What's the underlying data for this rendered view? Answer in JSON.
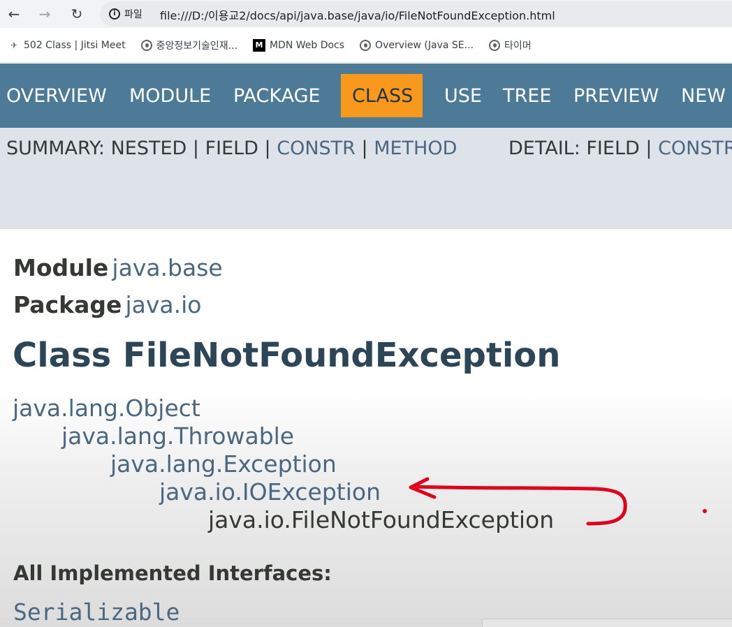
{
  "browser": {
    "info_label": "파일",
    "url": "file:///D:/이용교2/docs/api/java.base/java/io/FileNotFoundException.html",
    "bookmarks": [
      {
        "label": "502 Class | Jitsi Meet",
        "icon": "jitsi-icon"
      },
      {
        "label": "중앙정보기술인재...",
        "icon": "globe-icon"
      },
      {
        "label": "MDN Web Docs",
        "icon": "mdn-icon"
      },
      {
        "label": "Overview (Java SE...",
        "icon": "globe-icon"
      },
      {
        "label": "타이머",
        "icon": "globe-icon"
      }
    ]
  },
  "topnav": {
    "items": [
      "OVERVIEW",
      "MODULE",
      "PACKAGE",
      "CLASS",
      "USE",
      "TREE",
      "PREVIEW",
      "NEW"
    ],
    "active": "CLASS"
  },
  "subnav": {
    "summary_prefix": "SUMMARY: NESTED | FIELD | ",
    "constr": "CONSTR",
    "sep": " | ",
    "method": "METHOD",
    "detail_prefix": "DETAIL: FIELD | ",
    "detail_constr": "CONSTR"
  },
  "header": {
    "module_label": "Module",
    "module_name": "java.base",
    "package_label": "Package",
    "package_name": "java.io",
    "class_title": "Class FileNotFoundException"
  },
  "inheritance": [
    "java.lang.Object",
    "java.lang.Throwable",
    "java.lang.Exception",
    "java.io.IOException",
    "java.io.FileNotFoundException"
  ],
  "interfaces": {
    "label": "All Implemented Interfaces:",
    "items": [
      "Serializable"
    ]
  },
  "colors": {
    "nav_bg": "#4d7a97",
    "nav_active": "#f8981d",
    "subnav_bg": "#dee3e9",
    "link": "#4a6782",
    "title": "#2c4557",
    "annotation": "#e0001b"
  }
}
